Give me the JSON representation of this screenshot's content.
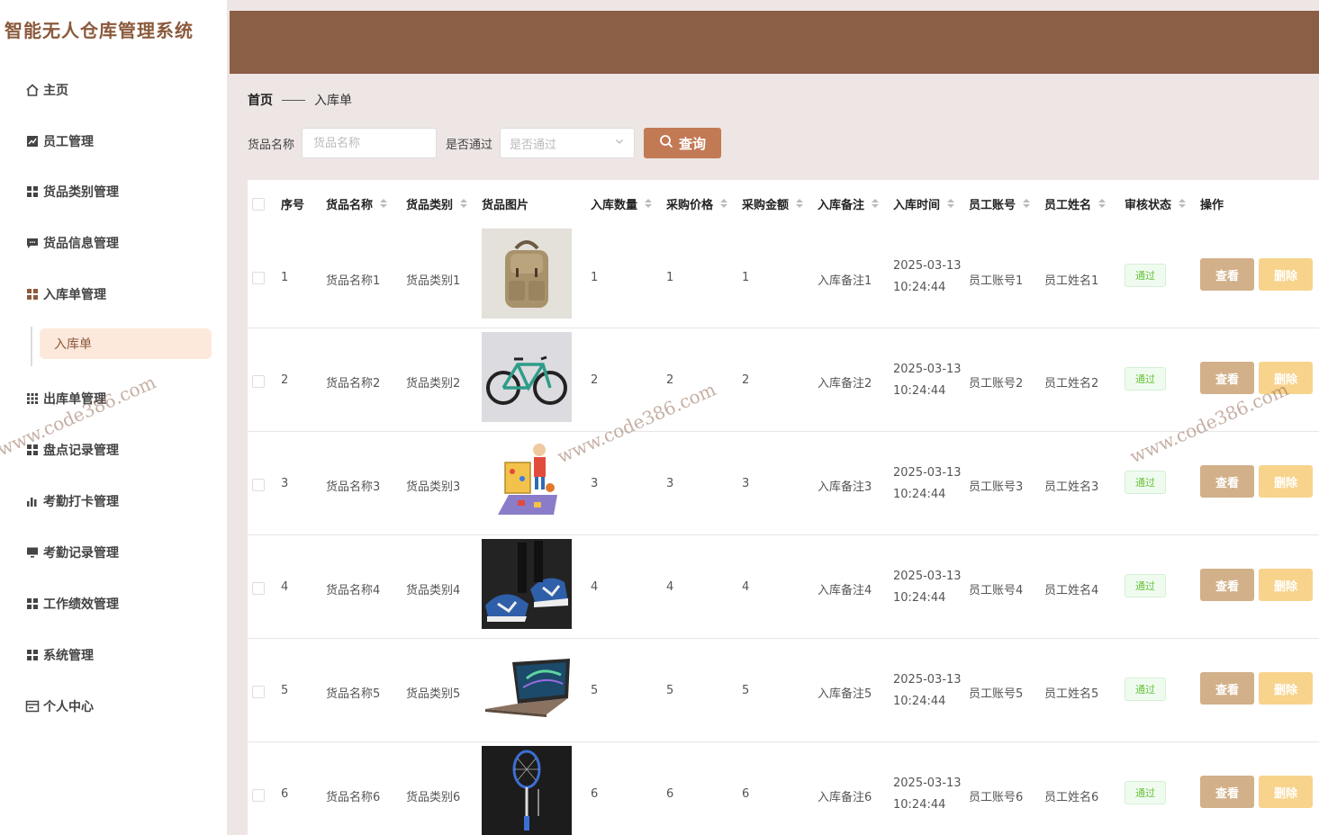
{
  "app": {
    "title": "智能无人仓库管理系统"
  },
  "sidebar": {
    "items": [
      {
        "label": "主页",
        "icon": "home-icon"
      },
      {
        "label": "员工管理",
        "icon": "chart-icon"
      },
      {
        "label": "货品类别管理",
        "icon": "grid-icon"
      },
      {
        "label": "货品信息管理",
        "icon": "message-icon"
      },
      {
        "label": "入库单管理",
        "icon": "grid-icon"
      },
      {
        "label": "出库单管理",
        "icon": "grid-icon"
      },
      {
        "label": "盘点记录管理",
        "icon": "grid-icon"
      },
      {
        "label": "考勤打卡管理",
        "icon": "bar-chart-icon"
      },
      {
        "label": "考勤记录管理",
        "icon": "monitor-icon"
      },
      {
        "label": "工作绩效管理",
        "icon": "grid-icon"
      },
      {
        "label": "系统管理",
        "icon": "grid-icon"
      },
      {
        "label": "个人中心",
        "icon": "card-icon"
      }
    ],
    "submenu": {
      "label": "入库单"
    }
  },
  "breadcrumb": {
    "home": "首页",
    "current": "入库单"
  },
  "search": {
    "name_label": "货品名称",
    "name_placeholder": "货品名称",
    "pass_label": "是否通过",
    "pass_placeholder": "是否通过",
    "query_label": "查询"
  },
  "table": {
    "headers": {
      "index": "序号",
      "name": "货品名称",
      "category": "货品类别",
      "image": "货品图片",
      "quantity": "入库数量",
      "price": "采购价格",
      "amount": "采购金额",
      "remark": "入库备注",
      "time": "入库时间",
      "account": "员工账号",
      "staff": "员工姓名",
      "status": "审核状态",
      "action": "操作"
    },
    "view_label": "查看",
    "delete_label": "删除",
    "rows": [
      {
        "index": "1",
        "name": "货品名称1",
        "category": "货品类别1",
        "image": "backpack",
        "quantity": "1",
        "price": "1",
        "amount": "1",
        "remark": "入库备注1",
        "date": "2025-03-13",
        "clock": "10:24:44",
        "account": "员工账号1",
        "staff": "员工姓名1",
        "status": "通过"
      },
      {
        "index": "2",
        "name": "货品名称2",
        "category": "货品类别2",
        "image": "bicycle",
        "quantity": "2",
        "price": "2",
        "amount": "2",
        "remark": "入库备注2",
        "date": "2025-03-13",
        "clock": "10:24:44",
        "account": "员工账号2",
        "staff": "员工姓名2",
        "status": "通过"
      },
      {
        "index": "3",
        "name": "货品名称3",
        "category": "货品类别3",
        "image": "toys",
        "quantity": "3",
        "price": "3",
        "amount": "3",
        "remark": "入库备注3",
        "date": "2025-03-13",
        "clock": "10:24:44",
        "account": "员工账号3",
        "staff": "员工姓名3",
        "status": "通过"
      },
      {
        "index": "4",
        "name": "货品名称4",
        "category": "货品类别4",
        "image": "sneakers",
        "quantity": "4",
        "price": "4",
        "amount": "4",
        "remark": "入库备注4",
        "date": "2025-03-13",
        "clock": "10:24:44",
        "account": "员工账号4",
        "staff": "员工姓名4",
        "status": "通过"
      },
      {
        "index": "5",
        "name": "货品名称5",
        "category": "货品类别5",
        "image": "laptop",
        "quantity": "5",
        "price": "5",
        "amount": "5",
        "remark": "入库备注5",
        "date": "2025-03-13",
        "clock": "10:24:44",
        "account": "员工账号5",
        "staff": "员工姓名5",
        "status": "通过"
      },
      {
        "index": "6",
        "name": "货品名称6",
        "category": "货品类别6",
        "image": "badminton-racket",
        "quantity": "6",
        "price": "6",
        "amount": "6",
        "remark": "入库备注6",
        "date": "2025-03-13",
        "clock": "10:24:44",
        "account": "员工账号6",
        "staff": "员工姓名6",
        "status": "通过"
      }
    ]
  },
  "watermarks": [
    "www.code386.com",
    "www.code386.com",
    "www.code386.com"
  ],
  "colors": {
    "banner": "#8b5e46",
    "accent": "#c27a55",
    "view": "#d2b08a",
    "delete": "#f7d38c",
    "pass": "#67c23a"
  }
}
